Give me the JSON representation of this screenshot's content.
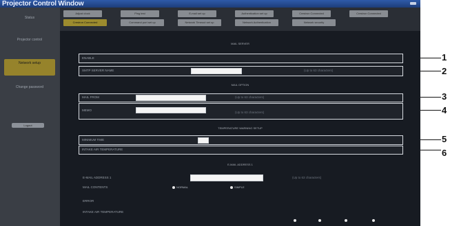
{
  "window": {
    "title": "Projector Control Window"
  },
  "sidebar": {
    "items": [
      {
        "label": "Status"
      },
      {
        "label": "Projector control"
      },
      {
        "label": "Network setup"
      },
      {
        "label": "Change password"
      }
    ],
    "button_label": "Logout"
  },
  "tabs": {
    "row1": [
      "Adjust clock",
      "Ping test",
      "E-mail set up",
      "Authentication set up",
      "Crestron Connected",
      "Crestron Connected"
    ],
    "row2": [
      "Crestron Connected",
      "Command port set up",
      "Network Timeout set up",
      "Network Authentication",
      "Network security"
    ]
  },
  "sections": {
    "mail_server": {
      "heading": "MAIL SERVER",
      "rows": [
        {
          "label": "ENABLE",
          "value": "",
          "note": ""
        },
        {
          "label": "SMTP SERVER NAME",
          "value": "",
          "note": "(Up to 63 characters)"
        }
      ]
    },
    "mail_option": {
      "heading": "MAIL OPTION",
      "rows": [
        {
          "label": "MAIL FROM",
          "value": "",
          "note": "(Up to 63 characters)"
        },
        {
          "label": "MEMO",
          "value": "",
          "note": "(Up to 63 characters)"
        }
      ]
    },
    "temperature_warning": {
      "heading": "TEMPERATURE WARNING SETUP",
      "rows": [
        {
          "label": "MINIMUM TIME",
          "value": "",
          "note": ""
        },
        {
          "label": "INTAKE AIR TEMPERATURE",
          "value": "",
          "note": ""
        }
      ]
    },
    "email_address_1": {
      "heading": "E-MAIL ADDRESS 1",
      "rows": [
        {
          "label": "E-MAIL ADDRESS 1",
          "value": "",
          "note": "(Up to 63 characters)"
        },
        {
          "label": "MAIL CONTENTS",
          "value": "",
          "note": ""
        },
        {
          "label": "ERROR",
          "value": "",
          "note": ""
        },
        {
          "label": "INTAKE AIR TEMPERATURE",
          "value": "",
          "note": ""
        }
      ],
      "radio_options": [
        "NORMAL",
        "SIMPLE"
      ]
    }
  },
  "callouts": [
    "1",
    "2",
    "3",
    "4",
    "5",
    "6"
  ],
  "colors": {
    "titlebar": "#2f5aa9",
    "background": "#171b22",
    "sidebar": "#3a3e45",
    "active": "#96832b",
    "tab": "#888c92",
    "border": "#d8dce2"
  }
}
